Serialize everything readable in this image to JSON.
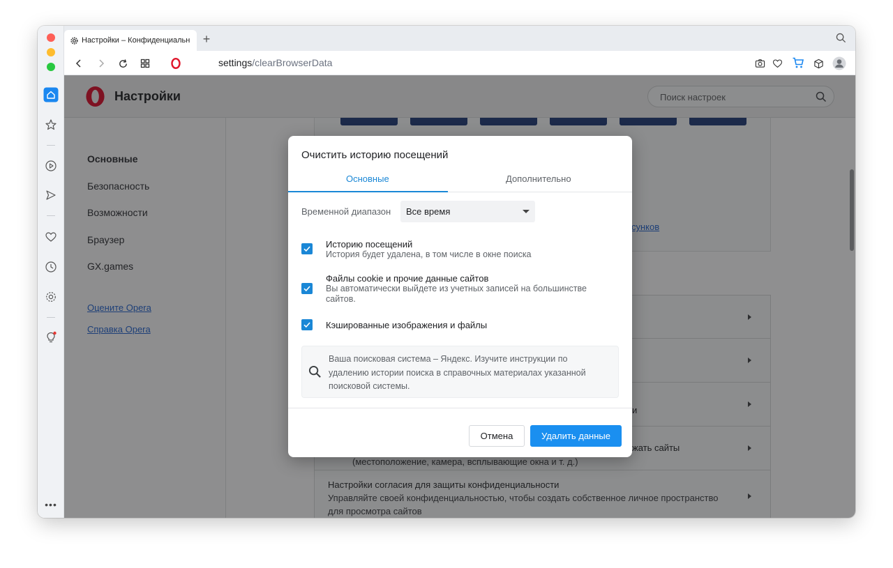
{
  "tab": {
    "title": "Настройки – Конфиденциальн"
  },
  "address": {
    "host": "settings",
    "path": "/clearBrowserData"
  },
  "header": {
    "title": "Настройки",
    "search_placeholder": "Поиск настроек"
  },
  "nav": {
    "items": [
      "Основные",
      "Безопасность",
      "Возможности",
      "Браузер",
      "GX.games"
    ],
    "links": [
      "Оцените Opera",
      "Справка Opera"
    ]
  },
  "background": {
    "link_fragment": "сунков",
    "row3_fragment": "и",
    "row4_title_fragment": "жать сайты",
    "row4_sub": "(местоположение, камера, всплывающие окна и т. д.)",
    "row5_title": "Настройки согласия для защиты конфиденциальности",
    "row5_sub": "Управляйте своей конфиденциальностью, чтобы создать собственное личное пространство для просмотра сайтов"
  },
  "dialog": {
    "title": "Очистить историю посещений",
    "tabs": [
      "Основные",
      "Дополнительно"
    ],
    "range_label": "Временной диапазон",
    "range_value": "Все время",
    "options": [
      {
        "title": "Историю посещений",
        "sub": "История будет удалена, в том числе в окне поиска"
      },
      {
        "title": "Файлы cookie и прочие данные сайтов",
        "sub": "Вы автоматически выйдете из учетных записей на большинстве сайтов."
      },
      {
        "title": "Кэшированные изображения и файлы",
        "sub": ""
      }
    ],
    "info": "Ваша поисковая система – Яндекс. Изучите инструкции по удалению истории поиска в справочных материалах указанной поисковой системы.",
    "cancel": "Отмена",
    "delete": "Удалить данные"
  },
  "colors": {
    "accent": "#1a87d6",
    "opera_red": "#e0172c"
  }
}
